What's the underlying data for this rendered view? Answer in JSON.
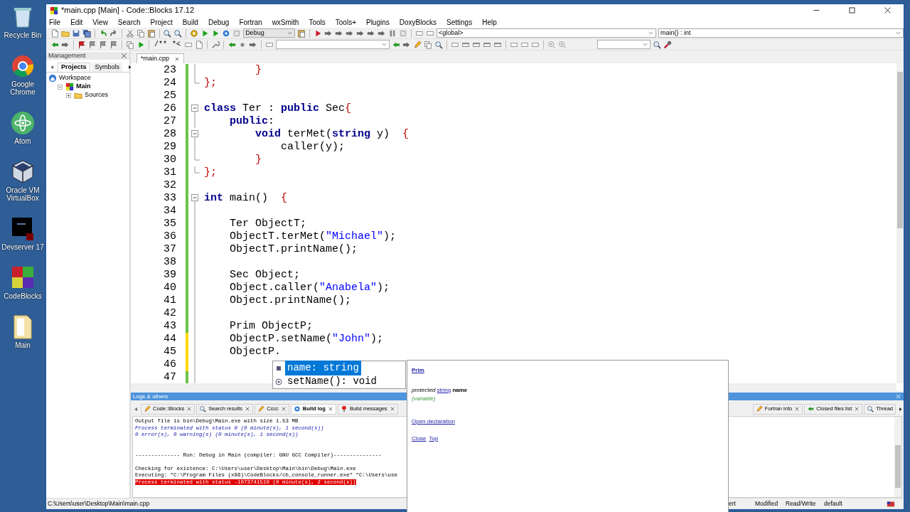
{
  "window": {
    "title": "*main.cpp [Main] - Code::Blocks 17.12"
  },
  "desktop_icons": [
    {
      "label": "Recycle Bin",
      "kind": "bin"
    },
    {
      "label": "Google Chrome",
      "kind": "browser"
    },
    {
      "label": "Atom",
      "kind": "atom"
    },
    {
      "label": "Oracle VM VirtualBox",
      "kind": "cube"
    },
    {
      "label": "Devserver 17",
      "kind": "server"
    },
    {
      "label": "CodeBlocks",
      "kind": "blocks"
    },
    {
      "label": "Main",
      "kind": "folder"
    }
  ],
  "menu": [
    "File",
    "Edit",
    "View",
    "Search",
    "Project",
    "Build",
    "Debug",
    "Fortran",
    "wxSmith",
    "Tools",
    "Tools+",
    "Plugins",
    "DoxyBlocks",
    "Settings",
    "Help"
  ],
  "toolbar": {
    "build_target": "Debug",
    "scope": "<global>",
    "function": "main() : int",
    "doxy_buttons": [
      "/**",
      "*<"
    ]
  },
  "management": {
    "title": "Management",
    "tabs": [
      {
        "label": "Projects",
        "selected": true
      },
      {
        "label": "Symbols",
        "selected": false
      }
    ],
    "tree": [
      {
        "label": "Workspace",
        "kind": "workspace",
        "children": [
          {
            "label": "Main",
            "kind": "project",
            "active": true,
            "expanded": true,
            "children": [
              {
                "label": "Sources",
                "kind": "folder",
                "expanded": false
              }
            ]
          }
        ]
      }
    ]
  },
  "editor": {
    "tab": {
      "label": "*main.cpp"
    },
    "lines": [
      {
        "number": "23",
        "modified": false,
        "kind": "fold_body",
        "tokens": [
          {
            "kind": "op",
            "text": "        }"
          }
        ]
      },
      {
        "number": "24",
        "modified": false,
        "kind": "fold_end",
        "tokens": [
          {
            "kind": "op",
            "text": "};"
          }
        ]
      },
      {
        "number": "25",
        "modified": false,
        "kind": "blank"
      },
      {
        "number": "26",
        "modified": false,
        "kind": "fold_start",
        "tokens": [
          {
            "kind": "kw",
            "text": "class"
          },
          {
            "kind": "plain",
            "text": " Ter : "
          },
          {
            "kind": "kw",
            "text": "public"
          },
          {
            "kind": "plain",
            "text": " Sec"
          },
          {
            "kind": "op",
            "text": "{"
          }
        ]
      },
      {
        "number": "27",
        "modified": false,
        "kind": "fold_body",
        "tokens": [
          {
            "kind": "kw",
            "text": "    public"
          },
          {
            "kind": "plain",
            "text": ":"
          }
        ]
      },
      {
        "number": "28",
        "modified": false,
        "kind": "fold_start",
        "tokens": [
          {
            "kind": "kw",
            "text": "        void"
          },
          {
            "kind": "plain",
            "text": " terMet("
          },
          {
            "kind": "kw",
            "text": "string"
          },
          {
            "kind": "plain",
            "text": " y)  "
          },
          {
            "kind": "op",
            "text": "{"
          }
        ]
      },
      {
        "number": "29",
        "modified": false,
        "kind": "fold_body",
        "tokens": [
          {
            "kind": "plain",
            "text": "            caller(y);"
          }
        ]
      },
      {
        "number": "30",
        "modified": false,
        "kind": "fold_end",
        "tokens": [
          {
            "kind": "op",
            "text": "        }"
          }
        ]
      },
      {
        "number": "31",
        "modified": false,
        "kind": "fold_end",
        "tokens": [
          {
            "kind": "op",
            "text": "};"
          }
        ]
      },
      {
        "number": "32",
        "modified": false,
        "kind": "blank"
      },
      {
        "number": "33",
        "modified": false,
        "kind": "fold_start",
        "tokens": [
          {
            "kind": "kw",
            "text": "int"
          },
          {
            "kind": "plain",
            "text": " main()  "
          },
          {
            "kind": "op",
            "text": "{"
          }
        ]
      },
      {
        "number": "34",
        "modified": false,
        "kind": "fold_body"
      },
      {
        "number": "35",
        "modified": false,
        "kind": "fold_body",
        "tokens": [
          {
            "kind": "plain",
            "text": "    Ter ObjectT;"
          }
        ]
      },
      {
        "number": "36",
        "modified": false,
        "kind": "fold_body",
        "tokens": [
          {
            "kind": "plain",
            "text": "    ObjectT.terMet("
          },
          {
            "kind": "str",
            "text": "\"Michael\""
          },
          {
            "kind": "plain",
            "text": ");"
          }
        ]
      },
      {
        "number": "37",
        "modified": false,
        "kind": "fold_body",
        "tokens": [
          {
            "kind": "plain",
            "text": "    ObjectT.printName();"
          }
        ]
      },
      {
        "number": "38",
        "modified": false,
        "kind": "fold_body"
      },
      {
        "number": "39",
        "modified": false,
        "kind": "fold_body",
        "tokens": [
          {
            "kind": "plain",
            "text": "    Sec Object;"
          }
        ]
      },
      {
        "number": "40",
        "modified": false,
        "kind": "fold_body",
        "tokens": [
          {
            "kind": "plain",
            "text": "    Object.caller("
          },
          {
            "kind": "str",
            "text": "\"Anabela\""
          },
          {
            "kind": "plain",
            "text": ");"
          }
        ]
      },
      {
        "number": "41",
        "modified": false,
        "kind": "fold_body",
        "tokens": [
          {
            "kind": "plain",
            "text": "    Object.printName();"
          }
        ]
      },
      {
        "number": "42",
        "modified": false,
        "kind": "fold_body"
      },
      {
        "number": "43",
        "modified": false,
        "kind": "fold_body",
        "tokens": [
          {
            "kind": "plain",
            "text": "    Prim ObjectP;"
          }
        ]
      },
      {
        "number": "44",
        "modified": true,
        "kind": "fold_body",
        "tokens": [
          {
            "kind": "plain",
            "text": "    ObjectP.setName("
          },
          {
            "kind": "str",
            "text": "\"John\""
          },
          {
            "kind": "plain",
            "text": ");"
          }
        ]
      },
      {
        "number": "45",
        "modified": true,
        "kind": "fold_body",
        "tokens": [
          {
            "kind": "plain",
            "text": "    ObjectP."
          }
        ]
      },
      {
        "number": "46",
        "modified": true,
        "kind": "fold_body"
      },
      {
        "number": "47",
        "modified": false,
        "kind": "fold_body"
      }
    ]
  },
  "autocomplete": [
    {
      "label": "name: string",
      "kind": "variable",
      "selected": true
    },
    {
      "label": "setName(): void",
      "kind": "function",
      "selected": false
    }
  ],
  "doc_popup": {
    "class_link": "Prim",
    "modifier": "protected",
    "type_link": "string",
    "member": "name",
    "category": "(variable)",
    "links": [
      "Open declaration"
    ],
    "footer_links": [
      "Close",
      "Top"
    ]
  },
  "logs": {
    "title": "Logs & others",
    "tabs": [
      {
        "label": "Code::Blocks",
        "kind": "pencil",
        "selected": false
      },
      {
        "label": "Search results",
        "kind": "search",
        "selected": false
      },
      {
        "label": "Cccc",
        "kind": "pencil",
        "selected": false
      },
      {
        "label": "Build log",
        "kind": "gear",
        "selected": true
      },
      {
        "label": "Build messages",
        "kind": "pin",
        "selected": false
      },
      {
        "label": "Fortran info",
        "kind": "pencil",
        "selected": false
      },
      {
        "label": "Closed files list",
        "kind": "arrow",
        "selected": false
      },
      {
        "label": "Thread",
        "kind": "search",
        "selected": false
      }
    ],
    "lines": [
      {
        "kind": "plain",
        "text": "Output file is bin\\Debug\\Main.exe with size 1.53 MB"
      },
      {
        "kind": "info",
        "text": "Process terminated with status 0 (0 minute(s), 1 second(s))"
      },
      {
        "kind": "info",
        "text": "0 error(s), 0 warning(s) (0 minute(s), 1 second(s))"
      },
      {
        "kind": "blank"
      },
      {
        "kind": "blank"
      },
      {
        "kind": "plain",
        "text": "-------------- Run: Debug in Main (compiler: GNU GCC Compiler)---------------"
      },
      {
        "kind": "blank"
      },
      {
        "kind": "plain",
        "text": "Checking for existence: C:\\Users\\user\\Desktop\\Main\\bin\\Debug\\Main.exe"
      },
      {
        "kind": "plain",
        "text": "Executing: \"C:\\Program Files (x86)\\CodeBlocks/cb_console_runner.exe\" \"C:\\Users\\use"
      },
      {
        "kind": "error",
        "text": "Process terminated with status -1073741510 (0 minute(s), 2 second(s))"
      }
    ]
  },
  "status_bar": {
    "path": "C:\\Users\\user\\Desktop\\Main\\main.cpp",
    "fields": [
      "ert",
      "Modified",
      "Read/Write",
      "default"
    ]
  }
}
